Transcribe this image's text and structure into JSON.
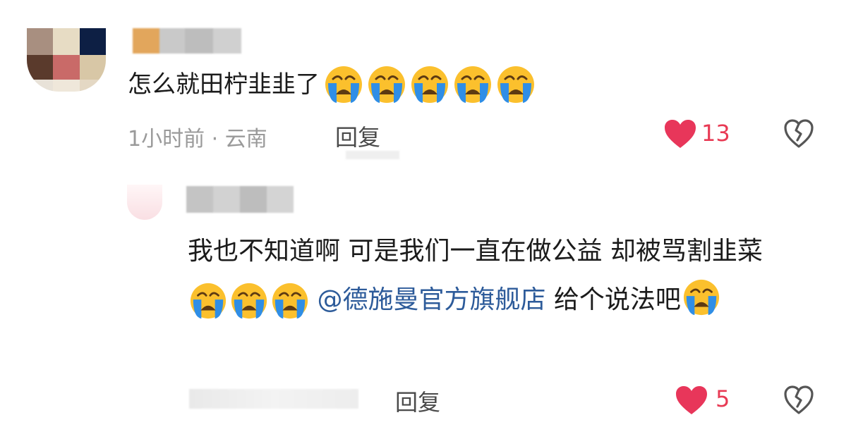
{
  "comment": {
    "text": "怎么就田柠韭韭了",
    "emoji_count": 5,
    "emoji_name": "loudly-crying-face",
    "meta": "1小时前 · 云南",
    "reply_label": "回复",
    "likes": "13",
    "accent": "#e83a54"
  },
  "reply": {
    "text_part1": "我也不知道啊 可是我们一直在做公益 却被骂割韭菜",
    "mention": "@德施曼官方旗舰店",
    "text_part2": " 给个说法吧",
    "reply_label": "回复",
    "likes": "5",
    "mention_color": "#2d5b9a"
  }
}
